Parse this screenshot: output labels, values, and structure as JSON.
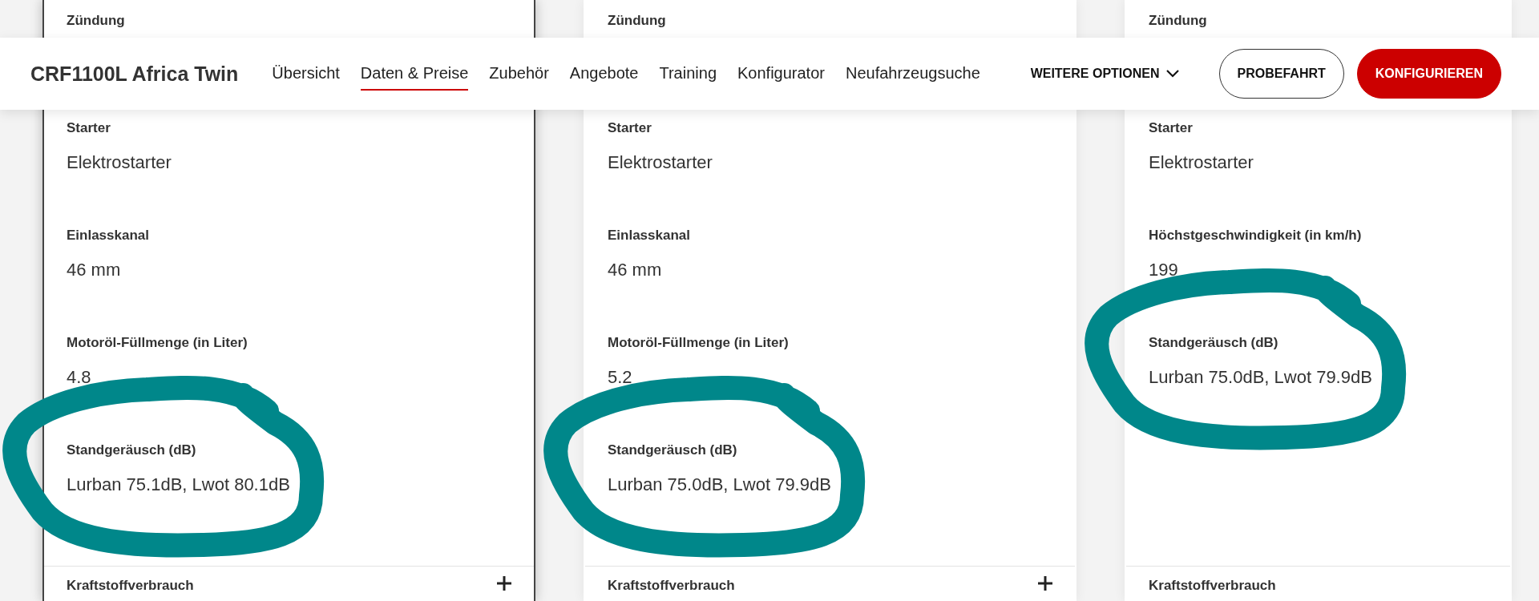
{
  "nav": {
    "title": "CRF1100L Africa Twin",
    "links": [
      {
        "label": "Übersicht",
        "selected": false
      },
      {
        "label": "Daten & Preise",
        "selected": true
      },
      {
        "label": "Zubehör",
        "selected": false
      },
      {
        "label": "Angebote",
        "selected": false
      },
      {
        "label": "Training",
        "selected": false
      },
      {
        "label": "Konfigurator",
        "selected": false
      },
      {
        "label": "Neufahrzeugsuche",
        "selected": false
      }
    ],
    "more": "WEITERE OPTIONEN",
    "buttons": [
      {
        "label": "PROBEFAHRT",
        "kind": "outline"
      },
      {
        "label": "KONFIGURIEREN",
        "kind": "primary"
      }
    ]
  },
  "cards": [
    {
      "highlighted": true,
      "top_label": "Zündung",
      "specs": [
        {
          "label": "Starter",
          "value": "Elektrostarter",
          "circled": false
        },
        {
          "label": "Einlasskanal",
          "value": "46 mm",
          "circled": false
        },
        {
          "label": "Motoröl-Füllmenge (in Liter)",
          "value": "4.8",
          "circled": false
        },
        {
          "label": "Standgeräusch (dB)",
          "value": "Lurban 75.1dB, Lwot 80.1dB",
          "circled": true
        }
      ],
      "footer": {
        "label": "Kraftstoffverbrauch",
        "expand_icon": true
      }
    },
    {
      "highlighted": false,
      "top_label": "Zündung",
      "specs": [
        {
          "label": "Starter",
          "value": "Elektrostarter",
          "circled": false
        },
        {
          "label": "Einlasskanal",
          "value": "46 mm",
          "circled": false
        },
        {
          "label": "Motoröl-Füllmenge (in Liter)",
          "value": "5.2",
          "circled": false
        },
        {
          "label": "Standgeräusch (dB)",
          "value": "Lurban 75.0dB, Lwot 79.9dB",
          "circled": true
        }
      ],
      "footer": {
        "label": "Kraftstoffverbrauch",
        "expand_icon": true
      }
    },
    {
      "highlighted": false,
      "top_label": "Zündung",
      "specs": [
        {
          "label": "Starter",
          "value": "Elektrostarter",
          "circled": false
        },
        {
          "label": "Höchstgeschwindigkeit (in km/h)",
          "value": "199",
          "circled": false
        },
        {
          "label": "Standgeräusch (dB)",
          "value": "Lurban 75.0dB, Lwot 79.9dB",
          "circled": true
        }
      ],
      "footer": {
        "label": "Kraftstoffverbrauch",
        "expand_icon": false
      }
    }
  ]
}
